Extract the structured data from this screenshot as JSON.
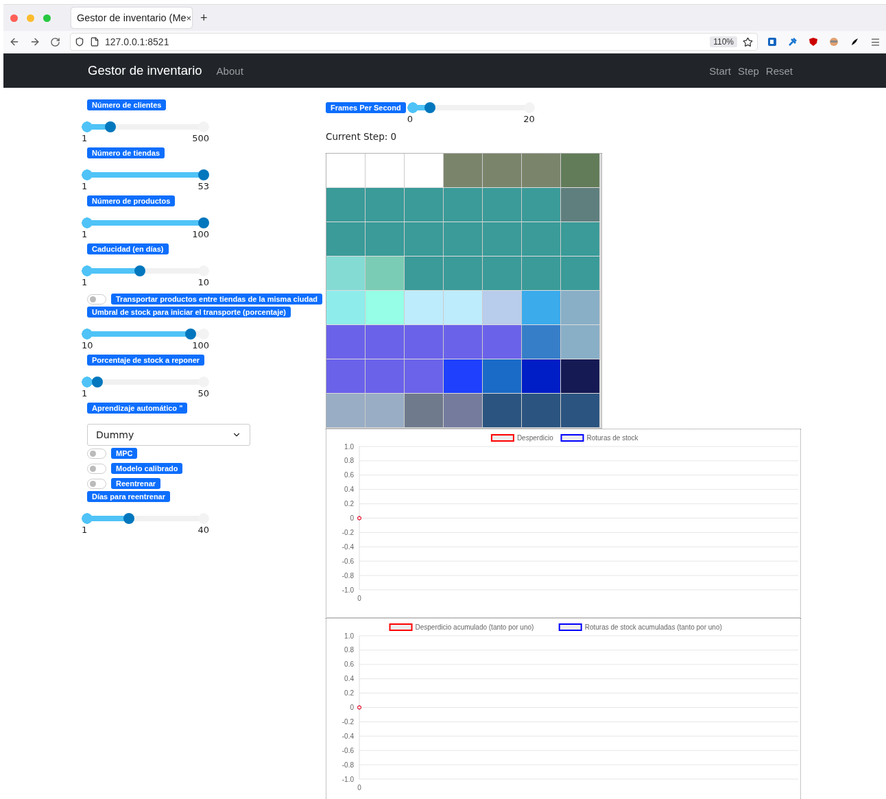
{
  "browser": {
    "tab_title": "Gestor de inventario (Me",
    "tab_close": "×",
    "new_tab": "+",
    "url": "127.0.0.1:8521",
    "zoom": "110%"
  },
  "navbar": {
    "brand": "Gestor de inventario",
    "links": [
      "About"
    ],
    "actions": [
      "Start",
      "Step",
      "Reset"
    ]
  },
  "controls": [
    {
      "kind": "slider",
      "label": "Número de clientes",
      "min": "1",
      "max": "500",
      "level": 0.2
    },
    {
      "kind": "slider",
      "label": "Número de tiendas",
      "min": "1",
      "max": "53",
      "level": 1
    },
    {
      "kind": "slider",
      "label": "Número de productos",
      "min": "1",
      "max": "100",
      "level": 1
    },
    {
      "kind": "slider",
      "label": "Caducidad (en días)",
      "min": "1",
      "max": "10",
      "level": 0.45
    },
    {
      "kind": "toggle",
      "label": "Transportar productos entre tiendas de la misma ciudad",
      "on": false
    },
    {
      "kind": "slider",
      "label": "Umbral de stock para iniciar el transporte (porcentaje)",
      "min": "10",
      "max": "100",
      "level": 0.89
    },
    {
      "kind": "slider",
      "label": "Porcentaje de stock a reponer",
      "min": "1",
      "max": "50",
      "level": 0.09
    },
    {
      "kind": "select",
      "label": "Aprendizaje automático \"",
      "value": "Dummy"
    },
    {
      "kind": "toggle",
      "label": "MPC",
      "on": false
    },
    {
      "kind": "toggle",
      "label": "Modelo calibrado",
      "on": false
    },
    {
      "kind": "toggle",
      "label": "Reentrenar",
      "on": false
    },
    {
      "kind": "slider",
      "label": "Días para reentrenar",
      "min": "1",
      "max": "40",
      "level": 0.36
    }
  ],
  "fps": {
    "label": "Frames Per Second",
    "min": "0",
    "max": "20",
    "level": 0.15
  },
  "current_step": "Current Step: 0",
  "grid": {
    "rows": [
      [
        {
          "color": "#ffffff"
        },
        {
          "color": "#ffffff"
        },
        {
          "color": "#ffffff"
        },
        {
          "color": "#7a846b"
        },
        {
          "color": "#7a846b"
        },
        {
          "color": "#7a846b"
        },
        {
          "color": "#627c59"
        }
      ],
      [
        {
          "color": "#3a9b98"
        },
        {
          "color": "#3a9b98"
        },
        {
          "color": "#3a9b98"
        },
        {
          "color": "#3a9b98"
        },
        {
          "color": "#3a9b98"
        },
        {
          "color": "#3a9b98"
        },
        {
          "color": "#5f7e7e"
        }
      ],
      [
        {
          "color": "#3a9b98"
        },
        {
          "color": "#3a9b98"
        },
        {
          "color": "#3a9b98"
        },
        {
          "color": "#3a9b98"
        },
        {
          "color": "#3a9b98"
        },
        {
          "color": "#3a9b98"
        },
        {
          "color": "#3a9b98"
        }
      ],
      [
        {
          "color": "#84dbd4"
        },
        {
          "color": "#7bccb4"
        },
        {
          "color": "#3a9b98"
        },
        {
          "color": "#3a9b98"
        },
        {
          "color": "#3a9b98"
        },
        {
          "color": "#3a9b98"
        },
        {
          "color": "#3a9b98"
        }
      ],
      [
        {
          "color": "#8eeceb"
        },
        {
          "color": "#96fde6"
        },
        {
          "color": "#bdecfd"
        },
        {
          "color": "#bdecfd"
        },
        {
          "color": "#b8cceb"
        },
        {
          "color": "#3babec"
        },
        {
          "color": "#89afc7"
        }
      ],
      [
        {
          "color": "#6b62ea"
        },
        {
          "color": "#6b62ea"
        },
        {
          "color": "#6b62ea"
        },
        {
          "color": "#6b62ea"
        },
        {
          "color": "#6b62ea"
        },
        {
          "color": "#377ec9"
        },
        {
          "color": "#89afc7"
        }
      ],
      [
        {
          "color": "#6b62ea"
        },
        {
          "color": "#6b62ea"
        },
        {
          "color": "#6b63e9"
        },
        {
          "color": "#1f40fd"
        },
        {
          "color": "#1a6bc7"
        },
        {
          "color": "#001ec5"
        },
        {
          "color": "#161a54"
        }
      ],
      [
        {
          "color": "#99adc4"
        },
        {
          "color": "#99adc4"
        },
        {
          "color": "#6f7a8c"
        },
        {
          "color": "#747b9d"
        },
        {
          "color": "#2b5480"
        },
        {
          "color": "#2b5480"
        },
        {
          "color": "#2b5480"
        }
      ]
    ]
  },
  "charts": [
    {
      "chart_data": {
        "type": "line",
        "categories": [
          "0"
        ],
        "ylim": [
          -1,
          1
        ],
        "grid": true,
        "legend": "top",
        "yticks": [
          {
            "value": 1,
            "label": "1.0"
          },
          {
            "value": 0.8,
            "label": "0.8"
          },
          {
            "value": 0.6,
            "label": "0.6"
          },
          {
            "value": 0.4,
            "label": "0.4"
          },
          {
            "value": 0.2,
            "label": "0.2"
          },
          0,
          {
            "value": -0.2,
            "label": "-0.2"
          },
          {
            "value": -0.4,
            "label": "-0.4"
          },
          {
            "value": -0.6,
            "label": "-0.6"
          },
          {
            "value": -0.8,
            "label": "-0.8"
          },
          {
            "value": -1,
            "label": "-1.0"
          }
        ],
        "series": [
          {
            "name": "Desperdicio",
            "color": "#ff0000",
            "marker": true,
            "values": [
              0
            ]
          },
          {
            "name": "Roturas de stock",
            "color": "#0000ff",
            "marker": true,
            "values": [
              0
            ]
          }
        ]
      }
    },
    {
      "chart_data": {
        "type": "line",
        "categories": [
          "0"
        ],
        "ylim": [
          -1,
          1
        ],
        "grid": true,
        "legend": "top",
        "yticks": [
          {
            "value": 1,
            "label": "1.0"
          },
          {
            "value": 0.8,
            "label": "0.8"
          },
          {
            "value": 0.6,
            "label": "0.6"
          },
          {
            "value": 0.4,
            "label": "0.4"
          },
          {
            "value": 0.2,
            "label": "0.2"
          },
          0,
          {
            "value": -0.2,
            "label": "-0.2"
          },
          {
            "value": -0.4,
            "label": "-0.4"
          },
          {
            "value": -0.6,
            "label": "-0.6"
          },
          {
            "value": -0.8,
            "label": "-0.8"
          },
          {
            "value": -1,
            "label": "-1.0"
          }
        ],
        "series": [
          {
            "name": "Desperdicio acumulado (tanto por uno)",
            "color": "#ff0000",
            "marker": true,
            "values": [
              0
            ]
          },
          {
            "name": "Roturas de stock acumuladas (tanto por uno)",
            "color": "#0000ff",
            "marker": true,
            "values": [
              0
            ]
          }
        ]
      }
    }
  ]
}
